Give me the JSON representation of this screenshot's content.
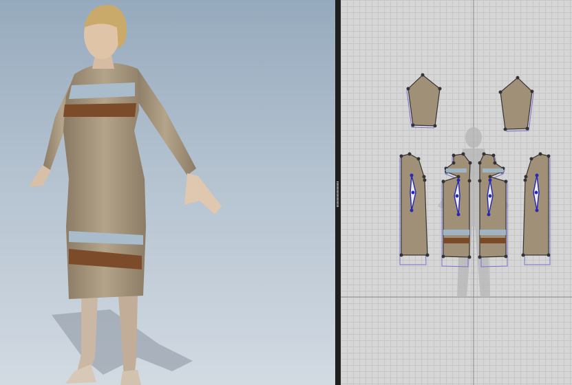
{
  "app": {
    "panes": [
      "3d-garment-view",
      "2d-pattern-view"
    ]
  },
  "colors": {
    "viewport_3d_top": "#96aabd",
    "viewport_3d_bottom": "#d2dae2",
    "pattern_canvas": "#d6d6d6",
    "fabric": "#a09078",
    "stripe_blue": "#9fb4c4",
    "stripe_brown": "#7a4a28",
    "pattern_outline": "#7a6fd0",
    "internal_points": "#2a2ab0"
  },
  "icons": {
    "divider_handle": "grip-icon"
  }
}
